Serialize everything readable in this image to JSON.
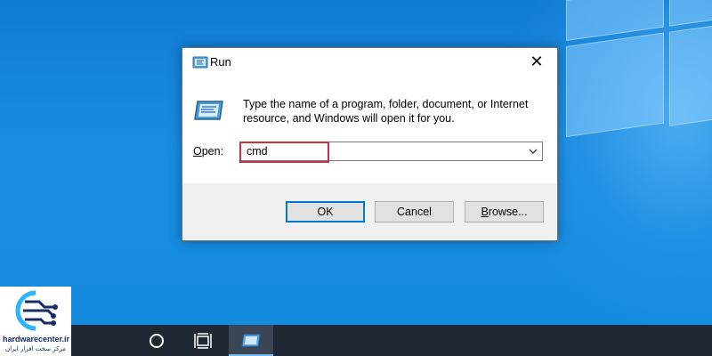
{
  "dialog": {
    "title": "Run",
    "close_glyph": "✕",
    "description": "Type the name of a program, folder, document, or Internet resource, and Windows will open it for you.",
    "open_label_prefix": "",
    "open_label_mnemonic": "O",
    "open_label_rest": "pen:",
    "open_value": "cmd",
    "buttons": {
      "ok": "OK",
      "cancel": "Cancel",
      "browse_mnemonic": "B",
      "browse_rest": "rowse..."
    },
    "icons": {
      "title": "run-icon",
      "app": "run-icon",
      "close": "close-icon",
      "dropdown": "chevron-down-icon"
    }
  },
  "taskbar": {
    "items": [
      "search-icon",
      "task-view-icon",
      "run-icon"
    ],
    "active_item": "run"
  },
  "watermark": {
    "brand": "hardwarecenter.ir",
    "tagline": "مرکز سخت افزار ایران"
  },
  "colors": {
    "desktop": "#1283d8",
    "taskbar": "#1f2936",
    "highlight": "#c7303d",
    "default_button_border": "#0078d7"
  }
}
